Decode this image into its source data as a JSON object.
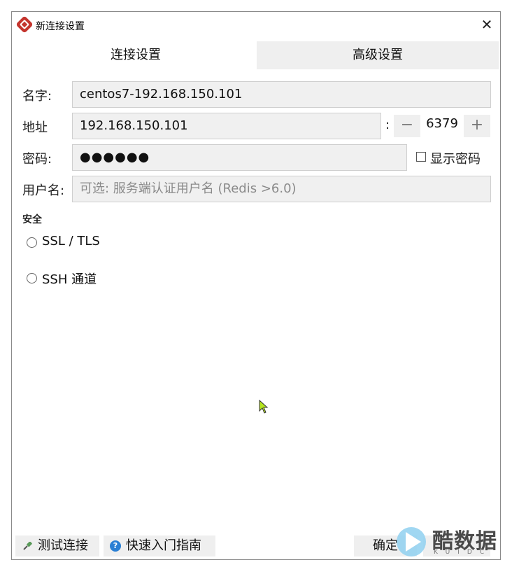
{
  "window": {
    "title": "新连接设置",
    "close_glyph": "✕"
  },
  "tabs": [
    {
      "label": "连接设置",
      "active": true
    },
    {
      "label": "高级设置",
      "active": false
    }
  ],
  "form": {
    "name": {
      "label": "名字:",
      "value": "centos7-192.168.150.101"
    },
    "address": {
      "label": "地址",
      "value": "192.168.150.101",
      "separator": ":"
    },
    "port": {
      "value": "6379",
      "minus": "−",
      "plus": "+"
    },
    "password": {
      "label": "密码:",
      "value": "●●●●●●",
      "show_label": "显示密码",
      "show_checked": false
    },
    "username": {
      "label": "用户名:",
      "value": "",
      "placeholder": "可选: 服务端认证用户名 (Redis >6.0)"
    }
  },
  "security": {
    "title": "安全",
    "options": [
      {
        "label": "SSL / TLS",
        "selected": false
      },
      {
        "label": "SSH 通道",
        "selected": false
      }
    ]
  },
  "footer": {
    "test_label": "测试连接",
    "guide_label": "快速入门指南",
    "ok_label": "确定",
    "cancel_label": ""
  },
  "watermark": {
    "text": "酷数据",
    "sub": "KUIDC"
  },
  "icons": {
    "app": "redis-logo-icon",
    "test": "plug-icon",
    "help": "question-icon"
  },
  "colors": {
    "app_icon": "#c4342d",
    "help_icon": "#2a7fd4",
    "field_bg": "#f0f0f0",
    "inactive_tab": "#efefef",
    "cursor": "#b5e61d"
  }
}
